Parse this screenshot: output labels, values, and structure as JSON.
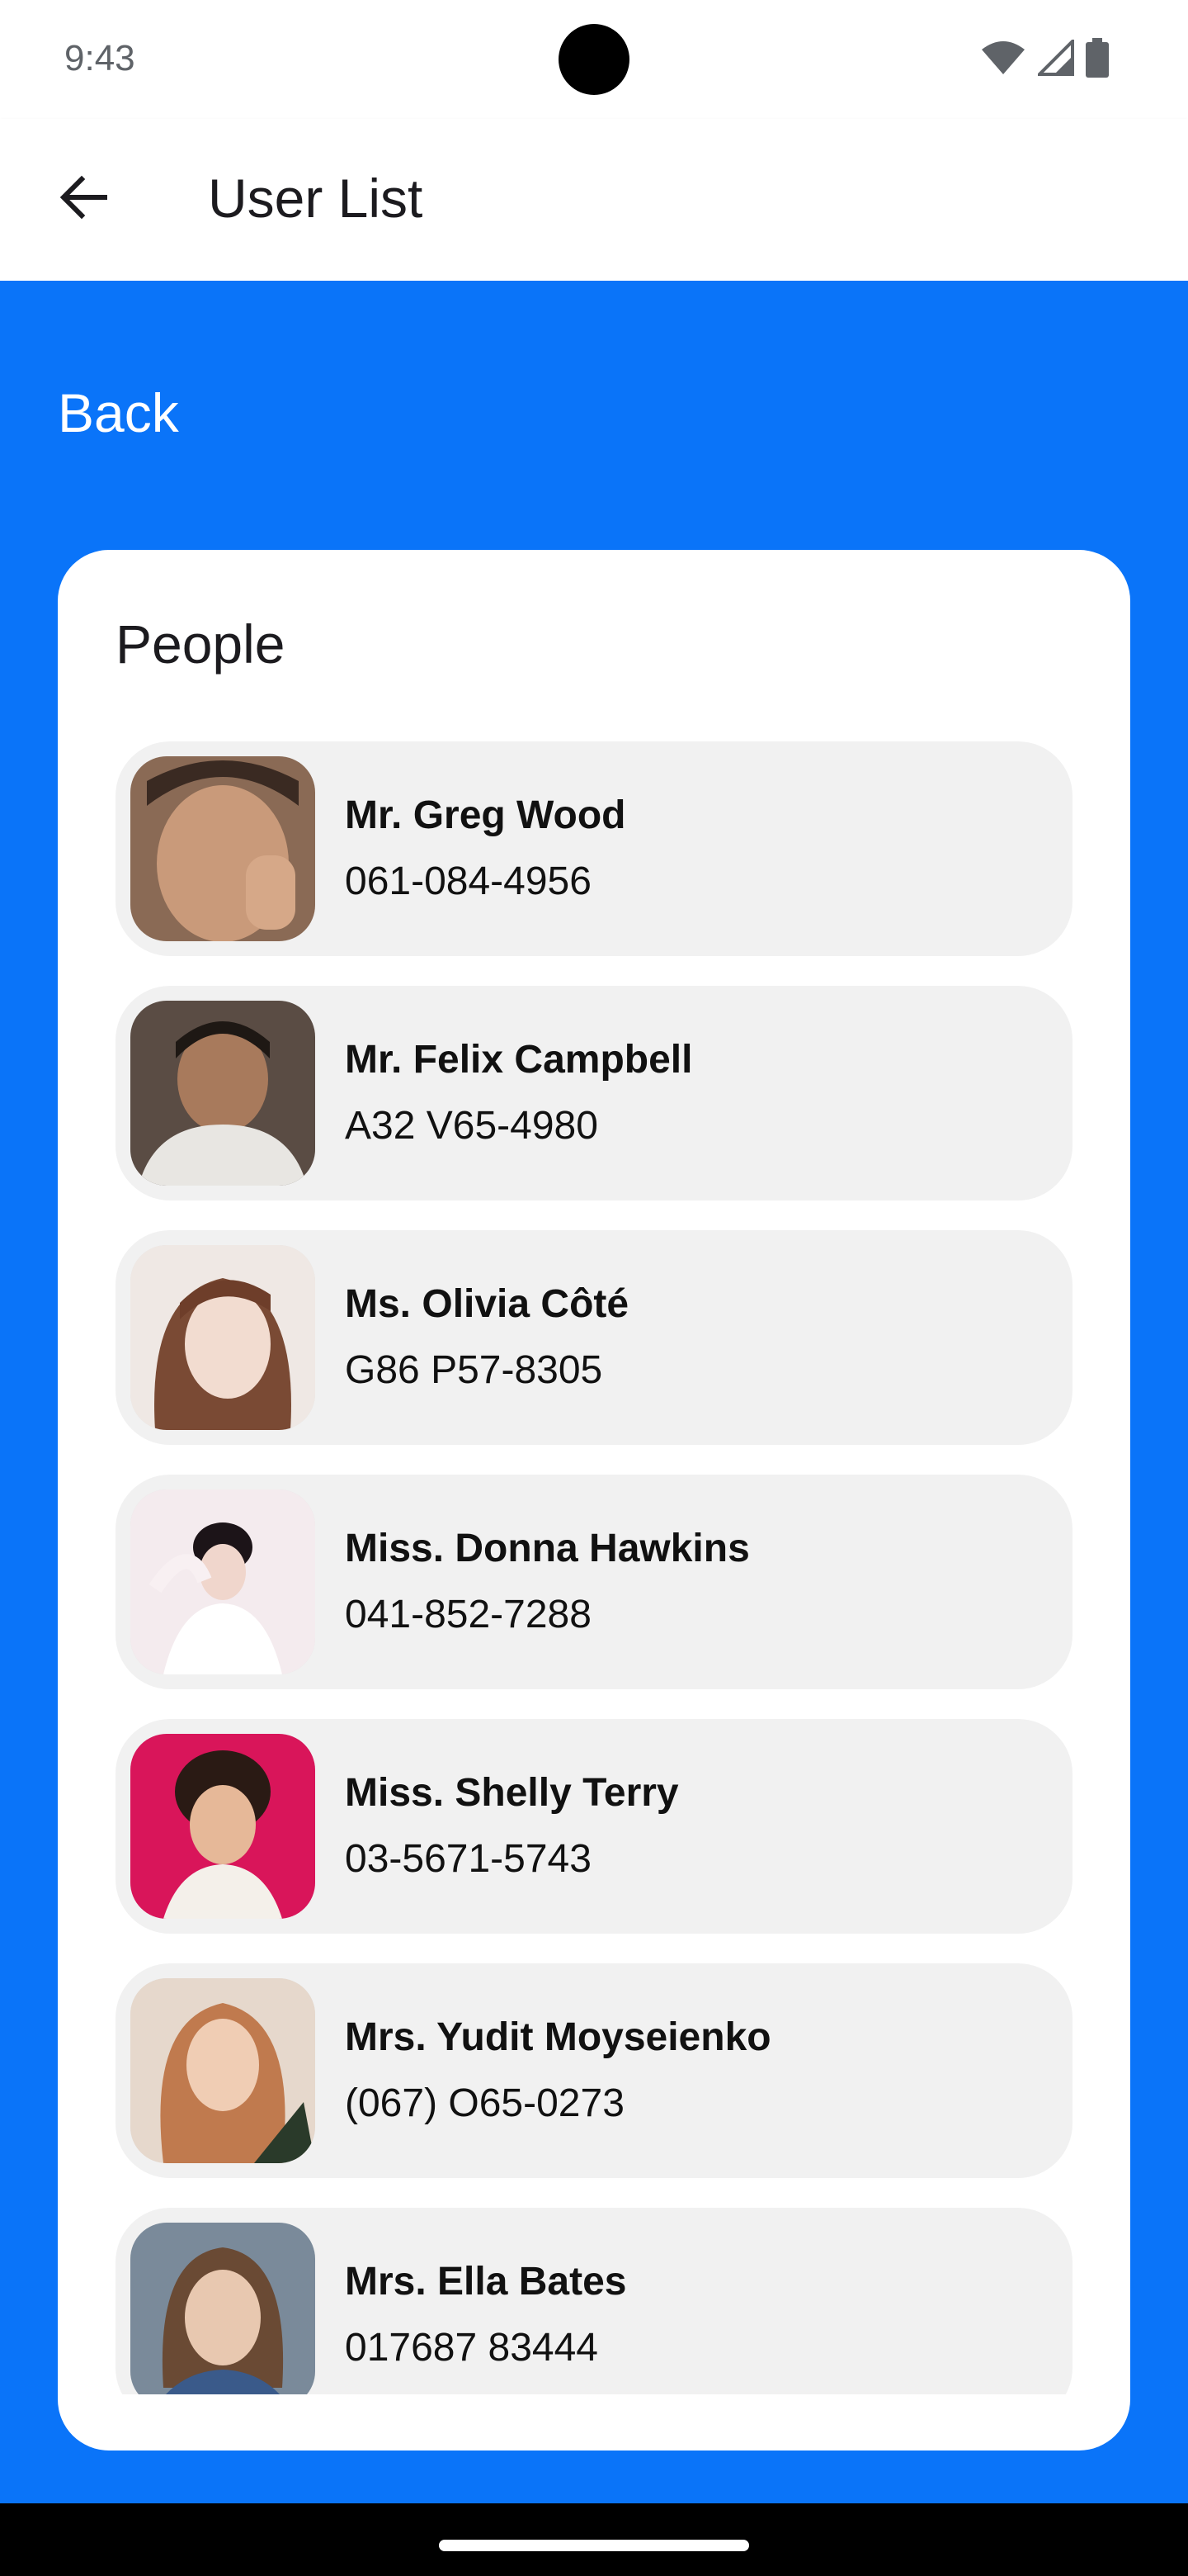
{
  "status_bar": {
    "time": "9:43",
    "icons": [
      "wifi-icon",
      "signal-icon",
      "battery-icon"
    ]
  },
  "app_bar": {
    "title": "User List",
    "back_icon": "arrow-back-icon"
  },
  "content": {
    "back_label": "Back",
    "background_color": "#0a74f9",
    "card_title": "People",
    "people": [
      {
        "name": "Mr. Greg Wood",
        "phone": "061-084-4956",
        "avatar_color": "#b98a6c"
      },
      {
        "name": "Mr. Felix Campbell",
        "phone": "A32 V65-4980",
        "avatar_color": "#6b5a4e"
      },
      {
        "name": "Ms. Olivia Côté",
        "phone": "G86 P57-8305",
        "avatar_color": "#e9d8d0"
      },
      {
        "name": "Miss. Donna Hawkins",
        "phone": "041-852-7288",
        "avatar_color": "#f3e9ec"
      },
      {
        "name": "Miss. Shelly Terry",
        "phone": "03-5671-5743",
        "avatar_color": "#d9155a"
      },
      {
        "name": "Mrs. Yudit Moyseienko",
        "phone": "(067) O65-0273",
        "avatar_color": "#d8c2b0"
      },
      {
        "name": "Mrs. Ella Bates",
        "phone": "017687 83444",
        "avatar_color": "#7a8a9a"
      }
    ]
  }
}
